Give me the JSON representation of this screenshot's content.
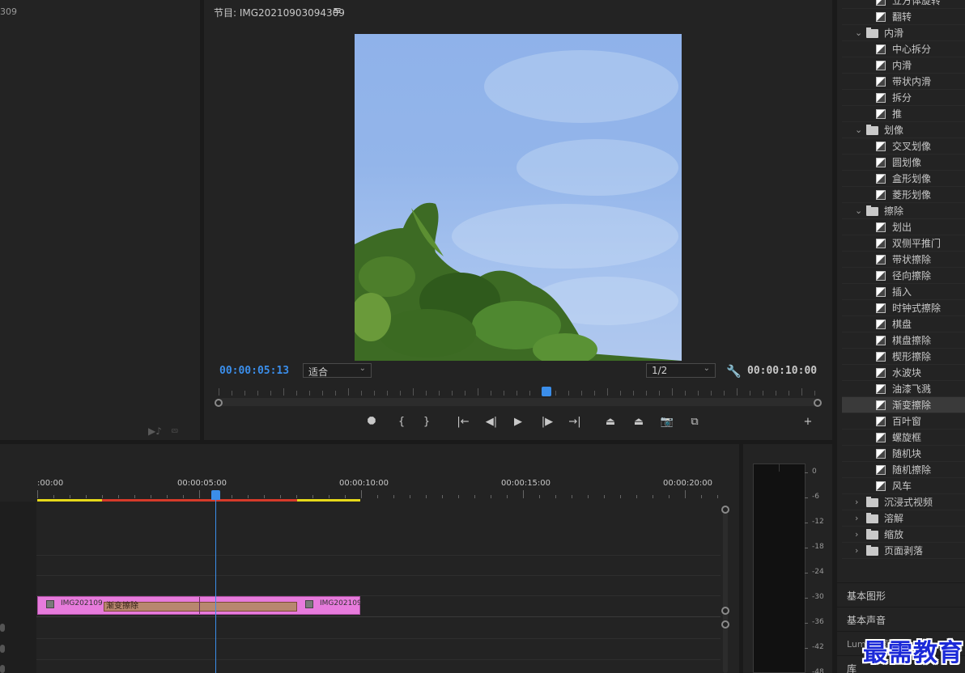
{
  "source": {
    "title_fragment": "309"
  },
  "program": {
    "title": "节目: IMG20210903094309",
    "menu_icon": "hamburger-icon",
    "timecode_current": "00:00:05:13",
    "timecode_total": "00:00:10:00",
    "fit": "适合",
    "resolution": "1/2",
    "playhead_fraction": 0.545,
    "colors": {
      "accent": "#3b8eea"
    }
  },
  "controls": [
    {
      "name": "add-marker-button",
      "glyph": "⯃"
    },
    {
      "name": "mark-in-button",
      "glyph": "{"
    },
    {
      "name": "mark-out-button",
      "glyph": "}"
    },
    {
      "name": "go-to-in-button",
      "glyph": "|←"
    },
    {
      "name": "step-back-button",
      "glyph": "◀|"
    },
    {
      "name": "play-button",
      "glyph": "▶"
    },
    {
      "name": "step-forward-button",
      "glyph": "|▶"
    },
    {
      "name": "go-to-out-button",
      "glyph": "→|"
    },
    {
      "name": "lift-button",
      "glyph": "⏏"
    },
    {
      "name": "extract-button",
      "glyph": "⏏"
    },
    {
      "name": "export-frame-button",
      "glyph": "📷"
    },
    {
      "name": "comparison-view-button",
      "glyph": "⧉"
    },
    {
      "name": "add-button",
      "glyph": "+"
    }
  ],
  "effects": {
    "rows": [
      {
        "type": "item",
        "label": "立方体旋转"
      },
      {
        "type": "item",
        "label": "翻转"
      },
      {
        "type": "folder",
        "label": "内滑",
        "expanded": true
      },
      {
        "type": "item",
        "label": "中心拆分"
      },
      {
        "type": "item",
        "label": "内滑"
      },
      {
        "type": "item",
        "label": "带状内滑"
      },
      {
        "type": "item",
        "label": "拆分"
      },
      {
        "type": "item",
        "label": "推"
      },
      {
        "type": "folder",
        "label": "划像",
        "expanded": true
      },
      {
        "type": "item",
        "label": "交叉划像"
      },
      {
        "type": "item",
        "label": "圆划像"
      },
      {
        "type": "item",
        "label": "盒形划像"
      },
      {
        "type": "item",
        "label": "菱形划像"
      },
      {
        "type": "folder",
        "label": "擦除",
        "expanded": true
      },
      {
        "type": "item",
        "label": "划出"
      },
      {
        "type": "item",
        "label": "双侧平推门"
      },
      {
        "type": "item",
        "label": "带状擦除"
      },
      {
        "type": "item",
        "label": "径向擦除"
      },
      {
        "type": "item",
        "label": "插入"
      },
      {
        "type": "item",
        "label": "时钟式擦除"
      },
      {
        "type": "item",
        "label": "棋盘"
      },
      {
        "type": "item",
        "label": "棋盘擦除"
      },
      {
        "type": "item",
        "label": "楔形擦除"
      },
      {
        "type": "item",
        "label": "水波块"
      },
      {
        "type": "item",
        "label": "油漆飞溅"
      },
      {
        "type": "item",
        "label": "渐变擦除",
        "selected": true
      },
      {
        "type": "item",
        "label": "百叶窗"
      },
      {
        "type": "item",
        "label": "螺旋框"
      },
      {
        "type": "item",
        "label": "随机块"
      },
      {
        "type": "item",
        "label": "随机擦除"
      },
      {
        "type": "item",
        "label": "风车"
      },
      {
        "type": "folder",
        "label": "沉浸式视频",
        "expanded": false
      },
      {
        "type": "folder",
        "label": "溶解",
        "expanded": false
      },
      {
        "type": "folder",
        "label": "缩放",
        "expanded": false
      },
      {
        "type": "folder",
        "label": "页面剥落",
        "expanded": false
      }
    ]
  },
  "panels": {
    "essential_graphics": "基本图形",
    "essential_sound": "基本声音",
    "lumetri": "Lumetri 范围",
    "libraries": "库"
  },
  "timeline": {
    "time_labels": [
      ":00:00",
      "00:00:05:00",
      "00:00:10:00",
      "00:00:15:00",
      "00:00:20:00"
    ],
    "clip": {
      "left_label": "IMG202109",
      "right_label": "IMG202109",
      "transition": "渐变擦除",
      "color": "#e77bdc"
    }
  },
  "meter": {
    "db_labels": [
      "0",
      "-6",
      "-12",
      "-18",
      "-24",
      "-30",
      "-36",
      "-42",
      "-48"
    ]
  },
  "watermark": "最需教育"
}
